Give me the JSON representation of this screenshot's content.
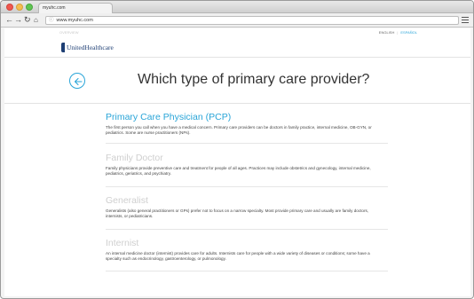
{
  "browser": {
    "tab_title": "myuhc.com",
    "url": "www.myuhc.com"
  },
  "header": {
    "faint_text": "OVERVIEW",
    "lang_en": "ENGLISH",
    "lang_sep": "|",
    "lang_es": "ESPAÑOL",
    "logo_text": "UnitedHealthcare"
  },
  "main": {
    "title": "Which type of primary care provider?",
    "options": [
      {
        "title": "Primary Care Physician (PCP)",
        "description": "The first person you call when you have a medical concern. Primary care providers can be doctors in family practice, internal medicine, OB-GYN, or pediatrics. Some are nurse practitioners (NPs)."
      },
      {
        "title": "Family Doctor",
        "description": "Family physicians provide preventive care and treatment for people of all ages. Practices may include obstetrics and gynecology, internal medicine, pediatrics, geriatrics, and psychiatry."
      },
      {
        "title": "Generalist",
        "description": "Generalists (also general practitioners or GPs) prefer not to focus on a narrow specialty. Most provide primary care and usually are family doctors, internists, or pediatricians."
      },
      {
        "title": "Internist",
        "description": "An internal medicine doctor (internist) provides care for adults. Internists care for people with a wide variety of diseases or conditions; some have a specialty such as endocrinology, gastroenterology, or pulmonology."
      }
    ]
  },
  "colors": {
    "accent": "#2aa5d8",
    "brand": "#1e3f74",
    "muted_title": "#cfcfcf"
  }
}
